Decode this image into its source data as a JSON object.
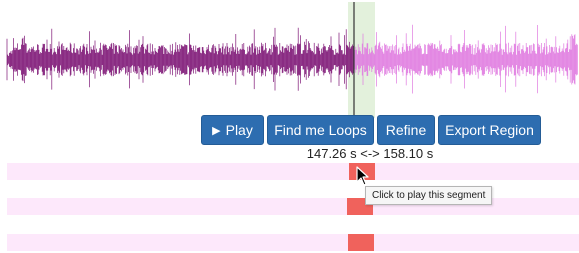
{
  "waveform": {
    "played_color": "#7d1475",
    "remaining_color": "#e07ae0",
    "selection_color": "#e3f1dc",
    "playhead_color": "#333333"
  },
  "controls": {
    "play_label": "Play",
    "find_loops_label": "Find me Loops",
    "refine_label": "Refine",
    "export_label": "Export Region"
  },
  "selection": {
    "range_label": "147.26 s <-> 158.10 s"
  },
  "segments": {
    "track_color": "#fde8fb",
    "tracks": [
      {
        "segment_color": "#f0625c"
      },
      {
        "segment_color": "#f0625c"
      },
      {
        "segment_color": "#f0625c"
      }
    ],
    "tooltip": "Click to play this segment"
  }
}
